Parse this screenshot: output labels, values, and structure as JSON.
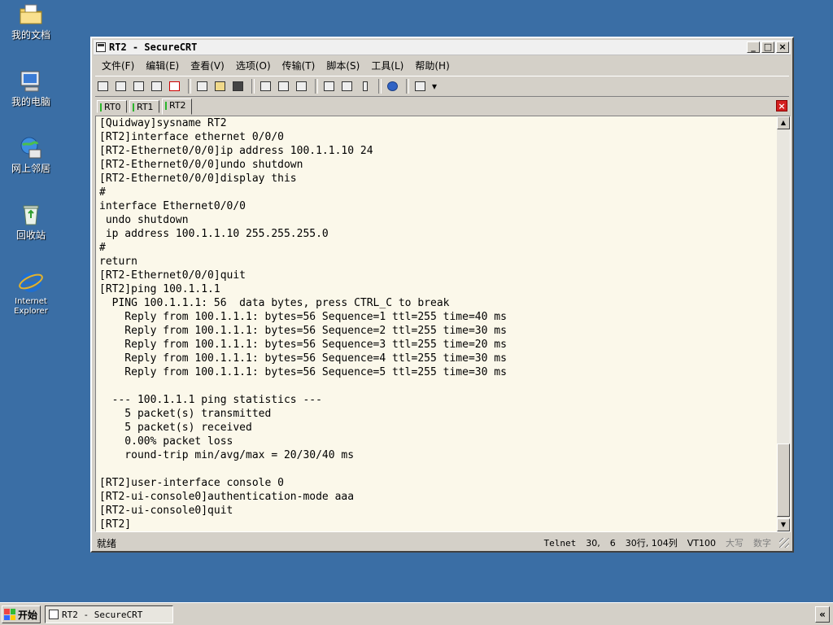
{
  "desktop": {
    "icons": [
      {
        "label": "我的文档",
        "icon": "folder-icon"
      },
      {
        "label": "我的电脑",
        "icon": "computer-icon"
      },
      {
        "label": "网上邻居",
        "icon": "network-icon"
      },
      {
        "label": "回收站",
        "icon": "recycle-bin-icon"
      },
      {
        "label_line1": "Internet",
        "label_line2": "Explorer",
        "icon": "internet-explorer-icon"
      }
    ]
  },
  "window": {
    "title": "RT2 - SecureCRT",
    "controls": {
      "minimize": "_",
      "maximize": "□",
      "close": "×"
    }
  },
  "menu": [
    "文件(F)",
    "编辑(E)",
    "查看(V)",
    "选项(O)",
    "传输(T)",
    "脚本(S)",
    "工具(L)",
    "帮助(H)"
  ],
  "tabs": [
    {
      "label": "RT0",
      "active": false
    },
    {
      "label": "RT1",
      "active": false
    },
    {
      "label": "RT2",
      "active": true
    }
  ],
  "tab_close": "×",
  "terminal": {
    "lines": [
      "[Quidway]sysname RT2",
      "[RT2]interface ethernet 0/0/0",
      "[RT2-Ethernet0/0/0]ip address 100.1.1.10 24",
      "[RT2-Ethernet0/0/0]undo shutdown",
      "[RT2-Ethernet0/0/0]display this",
      "#",
      "interface Ethernet0/0/0",
      " undo shutdown",
      " ip address 100.1.1.10 255.255.255.0",
      "#",
      "return",
      "[RT2-Ethernet0/0/0]quit",
      "[RT2]ping 100.1.1.1",
      "  PING 100.1.1.1: 56  data bytes, press CTRL_C to break",
      "    Reply from 100.1.1.1: bytes=56 Sequence=1 ttl=255 time=40 ms",
      "    Reply from 100.1.1.1: bytes=56 Sequence=2 ttl=255 time=30 ms",
      "    Reply from 100.1.1.1: bytes=56 Sequence=3 ttl=255 time=20 ms",
      "    Reply from 100.1.1.1: bytes=56 Sequence=4 ttl=255 time=30 ms",
      "    Reply from 100.1.1.1: bytes=56 Sequence=5 ttl=255 time=30 ms",
      "",
      "  --- 100.1.1.1 ping statistics ---",
      "    5 packet(s) transmitted",
      "    5 packet(s) received",
      "    0.00% packet loss",
      "    round-trip min/avg/max = 20/30/40 ms",
      "",
      "[RT2]user-interface console 0",
      "[RT2-ui-console0]authentication-mode aaa",
      "[RT2-ui-console0]quit",
      "[RT2]"
    ]
  },
  "status": {
    "ready": "就绪",
    "protocol": "Telnet",
    "row": "30,",
    "col": "6",
    "size": "30行, 104列",
    "terminal_type": "VT100",
    "caps": "大写",
    "num": "数字"
  },
  "taskbar": {
    "start": "开始",
    "task": "RT2 - SecureCRT",
    "tray_toggle": "«"
  },
  "colors": {
    "desktop": "#3a6ea5",
    "terminal_bg": "#fbf8ea",
    "tab_indicator": "#2bb52b",
    "close_red": "#d42020"
  }
}
